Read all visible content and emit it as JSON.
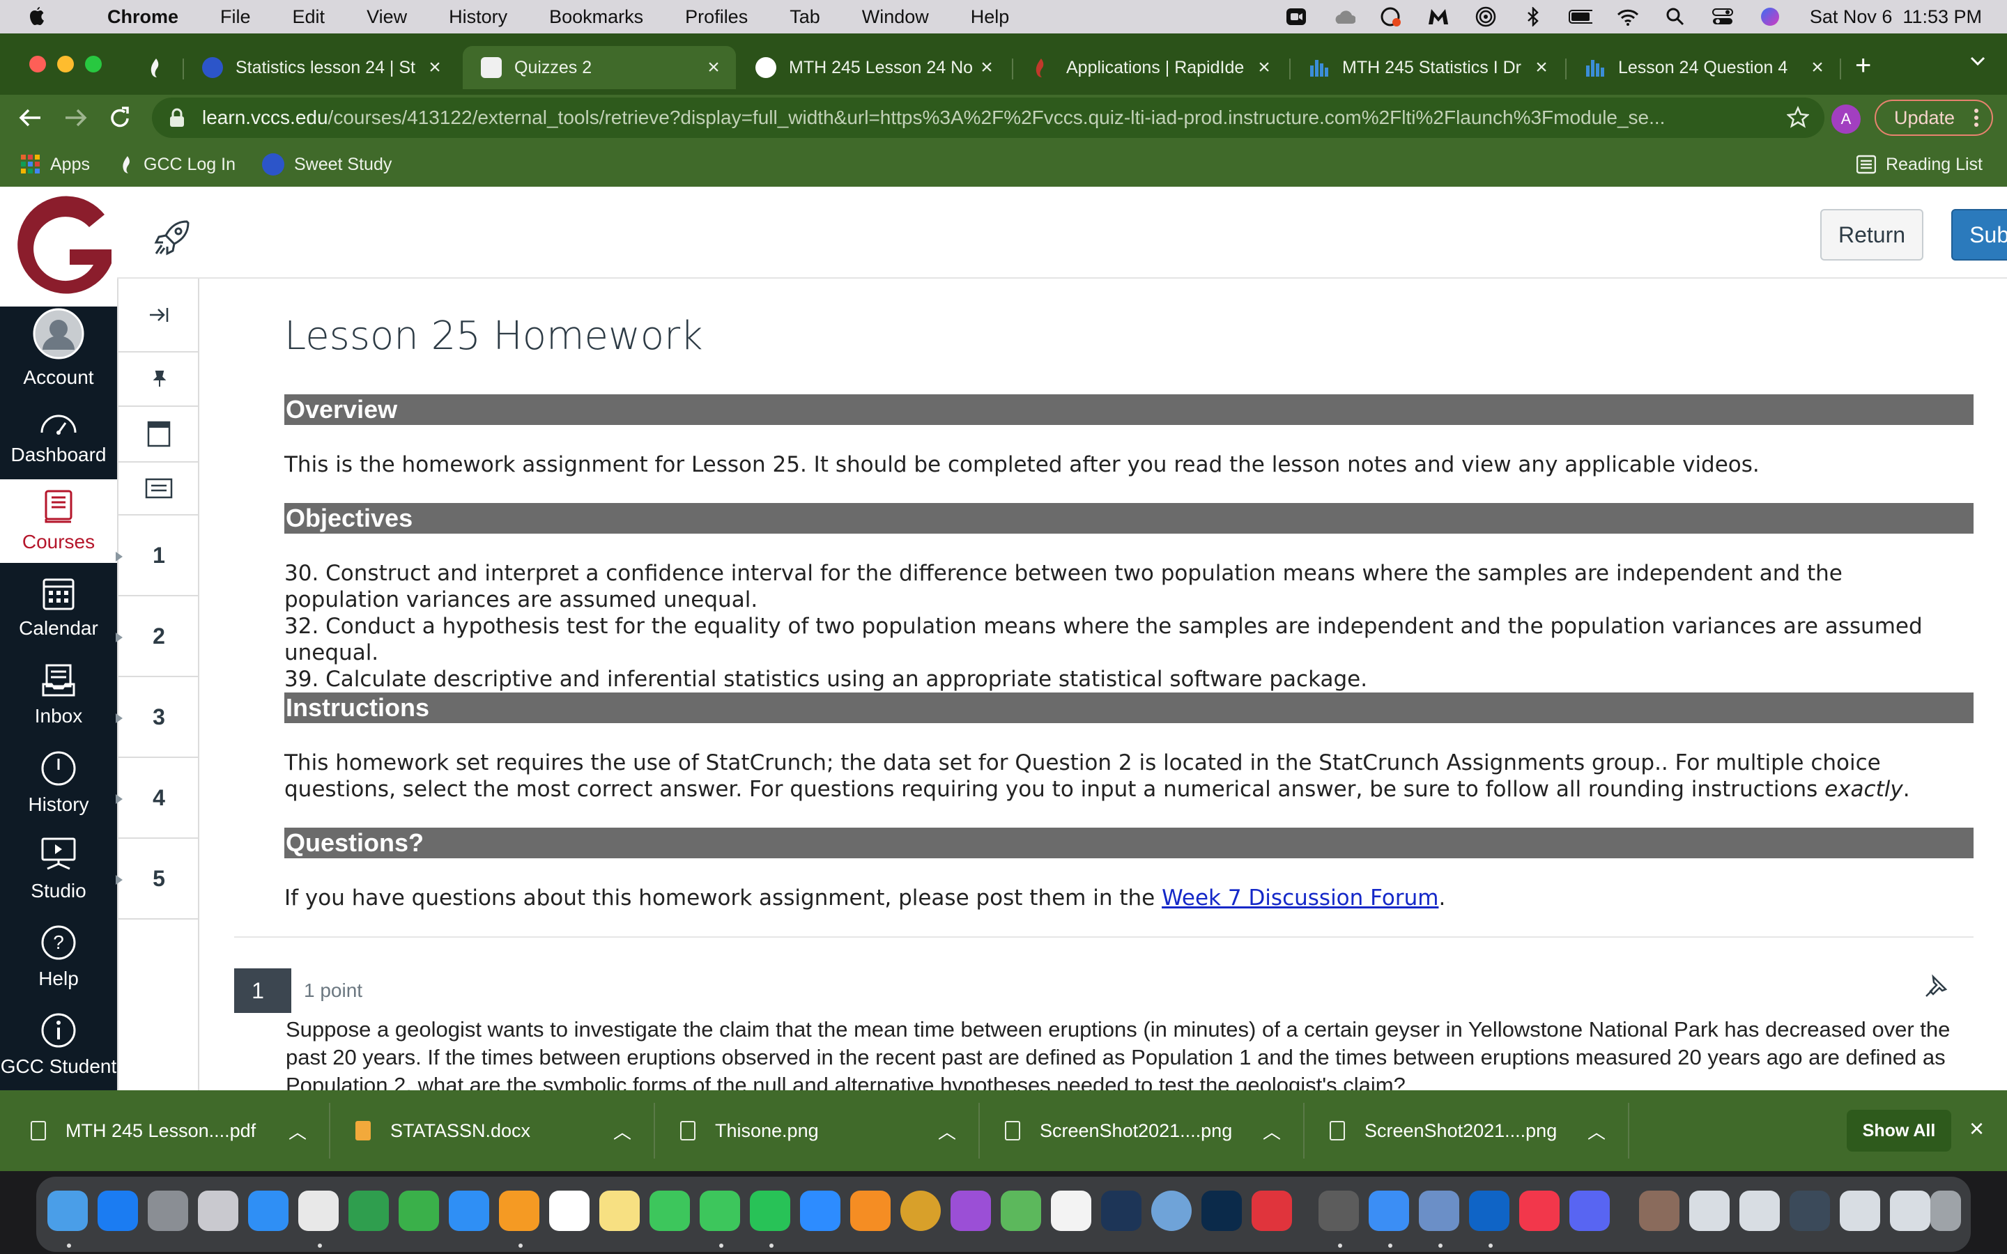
{
  "menubar": {
    "app_name": "Chrome",
    "menus": [
      "File",
      "Edit",
      "View",
      "History",
      "Bookmarks",
      "Profiles",
      "Tab",
      "Window",
      "Help"
    ],
    "clock": "Sat Nov 6  11:53 PM"
  },
  "tabs": [
    {
      "title": "Statistics lesson 24 | St",
      "active": false,
      "favicon_color": "#2c55c9"
    },
    {
      "title": "Quizzes 2",
      "active": true,
      "favicon_color": "#f0f0f0"
    },
    {
      "title": "MTH 245 Lesson 24 No",
      "active": false,
      "favicon_color": "#ffffff"
    },
    {
      "title": "Applications | RapidIde",
      "active": false,
      "favicon_color": "#c0392b"
    },
    {
      "title": "MTH 245 Statistics I Dr",
      "active": false,
      "favicon_color": "#3b8ed8"
    },
    {
      "title": "Lesson 24 Question 4",
      "active": false,
      "favicon_color": "#3b8ed8"
    }
  ],
  "toolbar": {
    "url_host": "learn.vccs.edu",
    "url_path": "/courses/413122/external_tools/retrieve?display=full_width&url=https%3A%2F%2Fvccs.quiz-lti-iad-prod.instructure.com%2Flti%2Flaunch%3Fmodule_se...",
    "profile_initial": "A",
    "update_label": "Update"
  },
  "bookmarks": {
    "apps_label": "Apps",
    "items": [
      "GCC Log In",
      "Sweet Study"
    ],
    "reading_list": "Reading List"
  },
  "global_nav": {
    "items": [
      {
        "label": "Account",
        "icon": "account-icon"
      },
      {
        "label": "Dashboard",
        "icon": "dashboard-icon"
      },
      {
        "label": "Courses",
        "icon": "courses-icon",
        "active": true
      },
      {
        "label": "Calendar",
        "icon": "calendar-icon"
      },
      {
        "label": "Inbox",
        "icon": "inbox-icon"
      },
      {
        "label": "History",
        "icon": "history-icon"
      },
      {
        "label": "Studio",
        "icon": "studio-icon"
      },
      {
        "label": "Help",
        "icon": "help-icon"
      },
      {
        "label": "GCC Student",
        "icon": "info-icon"
      }
    ]
  },
  "quiz_header": {
    "return_label": "Return",
    "submit_label": "Submit"
  },
  "question_nav": [
    "1",
    "2",
    "3",
    "4",
    "5"
  ],
  "content": {
    "title": "Lesson 25 Homework",
    "overview_heading": "Overview",
    "overview_text": "This is the homework assignment for Lesson 25. It should be completed after you read the lesson notes and view any applicable videos.",
    "objectives_heading": "Objectives",
    "objectives": [
      "30. Construct and interpret a confidence interval for the difference between two population means where the samples are independent and the population variances are assumed unequal.",
      "32. Conduct a hypothesis test for the equality of two population means where the samples are independent and the population variances are assumed unequal.",
      "39. Calculate descriptive and inferential statistics using an appropriate statistical software package."
    ],
    "instructions_heading": "Instructions",
    "instructions_text_a": "This homework set requires the use of StatCrunch; the data set for Question 2 is located in the StatCrunch Assignments group.. For multiple choice questions, select the most correct answer. For questions requiring you to input a numerical answer, be sure to follow all rounding instructions ",
    "instructions_text_em": "exactly",
    "instructions_text_b": ".",
    "questions_heading": "Questions?",
    "questions_text": "If you have questions about this homework assignment, please post them in the ",
    "questions_link": "Week 7 Discussion Forum",
    "questions_end": "."
  },
  "question1": {
    "number": "1",
    "points": "1 point",
    "text": "Suppose a geologist wants to investigate the claim that the mean time between eruptions (in minutes) of a certain geyser in Yellowstone National Park has decreased over the past 20 years. If the times between eruptions observed in the recent past are defined as Population 1 and the times between eruptions measured 20 years ago are defined as Population 2, what are the symbolic forms of the null and alternative hypotheses needed to test the geologist's claim?"
  },
  "downloads": {
    "items": [
      {
        "name": "MTH 245 Lesson....pdf",
        "color": "#e9efe4"
      },
      {
        "name": "STATASSN.docx",
        "color": "#f2a93b"
      },
      {
        "name": "Thisone.png",
        "color": "#e9efe4"
      },
      {
        "name": "ScreenShot2021....png",
        "color": "#e9efe4"
      },
      {
        "name": "ScreenShot2021....png",
        "color": "#e9efe4"
      }
    ],
    "show_all": "Show All"
  },
  "colors": {
    "chrome_frame": "#2b5219",
    "chrome_toolbar": "#406a2a",
    "canvas_nav": "#0e1a25",
    "canvas_red": "#b5162b",
    "submit_blue": "#2b7abc",
    "section_bar": "#6b6b6b"
  }
}
